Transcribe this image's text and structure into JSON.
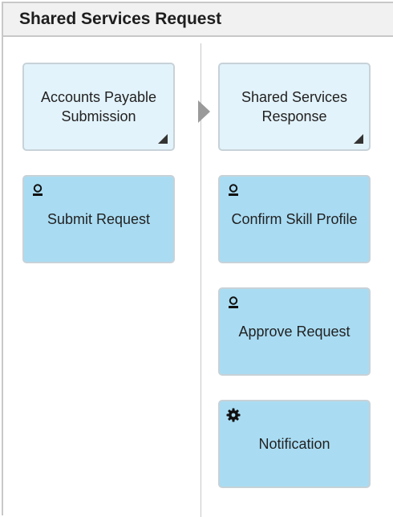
{
  "header": {
    "title": "Shared Services Request"
  },
  "lanes": [
    {
      "cards": [
        {
          "label": "Accounts Payable Submission",
          "type": "event",
          "icon": "corner-triangle-icon"
        },
        {
          "label": "Submit Request",
          "type": "task",
          "icon": "user-icon"
        }
      ]
    },
    {
      "cards": [
        {
          "label": "Shared Services Response",
          "type": "event",
          "icon": "corner-triangle-icon"
        },
        {
          "label": "Confirm Skill Profile",
          "type": "task",
          "icon": "user-icon"
        },
        {
          "label": "Approve Request",
          "type": "task",
          "icon": "user-icon"
        },
        {
          "label": "Notification",
          "type": "task",
          "icon": "gear-icon"
        }
      ]
    }
  ],
  "colors": {
    "event_card": "#e3f3fb",
    "task_card": "#a9dcf3",
    "border": "#c8c8c8",
    "header_bg": "#f1f1f1"
  }
}
